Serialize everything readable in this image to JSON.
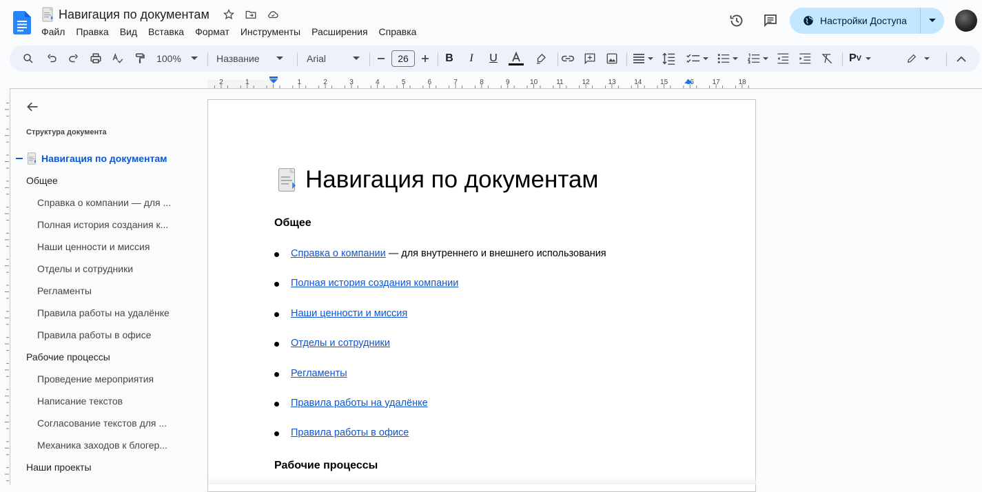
{
  "app": {
    "title": "Навигация по документам",
    "menus": [
      "Файл",
      "Правка",
      "Вид",
      "Вставка",
      "Формат",
      "Инструменты",
      "Расширения",
      "Справка"
    ],
    "share_label": "Настройки Доступа"
  },
  "toolbar": {
    "zoom": "100%",
    "style": "Название",
    "font": "Arial",
    "font_size": "26"
  },
  "ruler": {
    "labels": [
      "2",
      "1",
      "",
      "1",
      "2",
      "3",
      "4",
      "5",
      "6",
      "7",
      "8",
      "9",
      "10",
      "11",
      "12",
      "13",
      "14",
      "15",
      "16",
      "17",
      "18"
    ]
  },
  "outline": {
    "heading": "Структура документа",
    "title_item": "Навигация по документам",
    "items": [
      {
        "label": "Общее",
        "level": 1
      },
      {
        "label": "Справка о компании — для ...",
        "level": 2
      },
      {
        "label": "Полная история создания к...",
        "level": 2
      },
      {
        "label": "Наши ценности и миссия",
        "level": 2
      },
      {
        "label": "Отделы и сотрудники",
        "level": 2
      },
      {
        "label": "Регламенты",
        "level": 2
      },
      {
        "label": "Правила работы на удалёнке",
        "level": 2
      },
      {
        "label": "Правила работы в офисе",
        "level": 2
      },
      {
        "label": "Рабочие процессы",
        "level": 1
      },
      {
        "label": "Проведение мероприятия",
        "level": 2
      },
      {
        "label": "Написание текстов",
        "level": 2
      },
      {
        "label": "Согласование текстов для ...",
        "level": 2
      },
      {
        "label": "Механика заходов к блогер...",
        "level": 2
      },
      {
        "label": "Наши проекты",
        "level": 1
      }
    ]
  },
  "document": {
    "title": "Навигация по документам",
    "section1": "Общее",
    "items": [
      {
        "link": "Справка о компании",
        "rest": " — для внутреннего и внешнего использования"
      },
      {
        "link": "Полная история создания компании",
        "rest": ""
      },
      {
        "link": "Наши ценности и миссия",
        "rest": ""
      },
      {
        "link": "Отделы и сотрудники",
        "rest": ""
      },
      {
        "link": "Регламенты",
        "rest": ""
      },
      {
        "link": "Правила работы на удалёнке",
        "rest": ""
      },
      {
        "link": "Правила работы в офисе",
        "rest": ""
      }
    ],
    "section2": "Рабочие процессы"
  },
  "colors": {
    "link": "#1155cc",
    "accent": "#0b57d0",
    "share_bg": "#c2e7ff",
    "toolbar_bg": "#edf2fa"
  }
}
